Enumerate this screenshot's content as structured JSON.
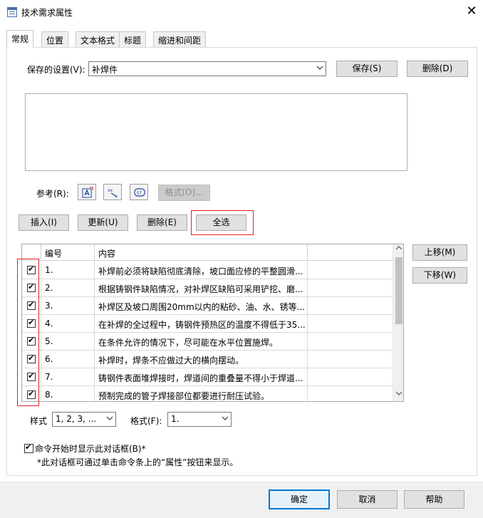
{
  "window": {
    "title": "技术需求属性"
  },
  "tabs": [
    {
      "label": "常规",
      "active": true
    },
    {
      "label": "位置"
    },
    {
      "label": "文本格式"
    },
    {
      "label": "标题"
    },
    {
      "label": "缩进和间距"
    }
  ],
  "saved_settings": {
    "label": "保存的设置(V):",
    "value": "补焊件",
    "save_label": "保存(S)",
    "delete_label": "删除(D)"
  },
  "reference": {
    "label": "参考(R):",
    "icons": [
      "insert-attribute-icon",
      "symbol-icon",
      "special-text-icon"
    ],
    "format_label": "格式(O)..."
  },
  "row_buttons": {
    "insert": "插入(I)",
    "update": "更新(U)",
    "delete": "删除(E)",
    "select_all": "全选"
  },
  "grid": {
    "columns": [
      "编号",
      "内容"
    ],
    "rows": [
      {
        "checked": true,
        "number": "1.",
        "content": "补焊前必须将缺陷彻底清除，坡口面应修的平整圆滑..."
      },
      {
        "checked": true,
        "number": "2.",
        "content": "根据铸钢件缺陷情况，对补焊区缺陷可采用铲挖、磨..."
      },
      {
        "checked": true,
        "number": "3.",
        "content": "补焊区及坡口周围20mm以内的粘砂、油、水、锈等..."
      },
      {
        "checked": true,
        "number": "4.",
        "content": "在补焊的全过程中，铸钢件预热区的温度不得低于35..."
      },
      {
        "checked": true,
        "number": "5.",
        "content": "在条件允许的情况下，尽可能在水平位置施焊。"
      },
      {
        "checked": true,
        "number": "6.",
        "content": "补焊时，焊条不应做过大的横向摆动。"
      },
      {
        "checked": true,
        "number": "7.",
        "content": "铸钢件表面堆焊接时，焊道间的重叠量不得小于焊道..."
      },
      {
        "checked": true,
        "number": "8.",
        "content": "预制完成的管子焊接部位都要进行耐压试验。"
      }
    ]
  },
  "move_buttons": {
    "up": "上移(M)",
    "down": "下移(W)"
  },
  "style": {
    "label": "样式",
    "value": "1, 2, 3, ..."
  },
  "format": {
    "label": "格式(F):",
    "value": "1."
  },
  "show_dialog": {
    "checked": true,
    "label": "命令开始时显示此对话框(B)*",
    "note": "*此对话框可通过单击命令条上的“属性”按钮来显示。"
  },
  "footer": {
    "ok": "确定",
    "cancel": "取消",
    "help": "帮助"
  },
  "colors": {
    "accent": "#0078d7",
    "highlight": "#e02020"
  }
}
